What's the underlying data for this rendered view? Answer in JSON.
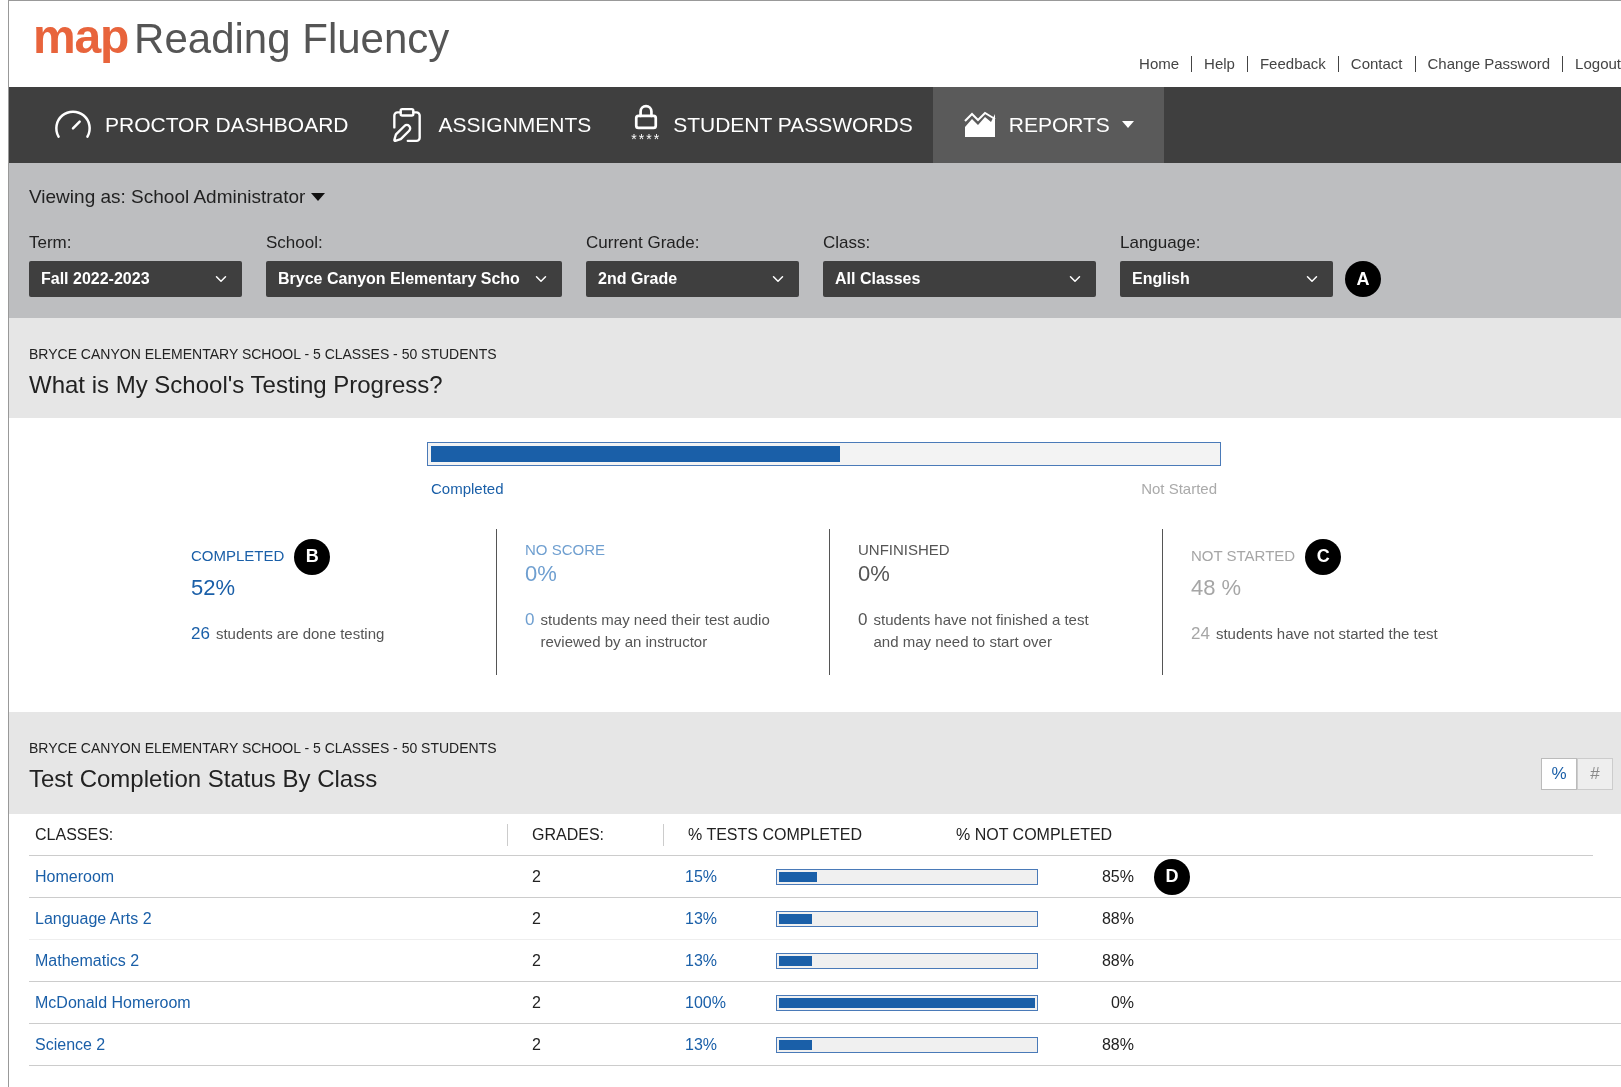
{
  "logo": {
    "brand": "map",
    "product": "Reading Fluency"
  },
  "top_links": [
    "Home",
    "Help",
    "Feedback",
    "Contact",
    "Change Password",
    "Logout"
  ],
  "nav": [
    {
      "kind": "dashboard",
      "label": "PROCTOR DASHBOARD",
      "selected": false
    },
    {
      "kind": "assignments",
      "label": "ASSIGNMENTS",
      "selected": false
    },
    {
      "kind": "passwords",
      "label": "STUDENT PASSWORDS",
      "badge": "****",
      "selected": false
    },
    {
      "kind": "reports",
      "label": "REPORTS",
      "selected": true,
      "has_menu": true
    }
  ],
  "viewing_as": "Viewing as: School Administrator",
  "filters": [
    {
      "label": "Term:",
      "value": "Fall 2022-2023"
    },
    {
      "label": "School:",
      "value": "Bryce Canyon Elementary Scho"
    },
    {
      "label": "Current Grade:",
      "value": "2nd Grade"
    },
    {
      "label": "Class:",
      "value": "All Classes"
    },
    {
      "label": "Language:",
      "value": "English",
      "callout": "A"
    }
  ],
  "progress_section": {
    "subtitle": "BRYCE CANYON ELEMENTARY SCHOOL - 5 CLASSES - 50 STUDENTS",
    "title": "What is My School's Testing Progress?",
    "bar": {
      "level": 0.52,
      "left_label": "Completed",
      "right_label": "Not Started"
    },
    "stats": [
      {
        "heading": "COMPLETED",
        "value": "52%",
        "count": "26",
        "description": "students are done testing",
        "color": "#1a5fa8",
        "callout": "B"
      },
      {
        "heading": "NO SCORE",
        "value": "0%",
        "count": "0",
        "description": "students may need their test audio reviewed by an instructor",
        "color": "#6f9fd0"
      },
      {
        "heading": "UNFINISHED",
        "value": "0%",
        "count": "0",
        "description": "students have not finished a test and may need to start over",
        "color": "#555555"
      },
      {
        "heading": "NOT STARTED",
        "value": "48 %",
        "count": "24",
        "description": "students have not started the test",
        "color": "#a6a6a6",
        "callout": "C"
      }
    ]
  },
  "class_section": {
    "subtitle": "BRYCE CANYON ELEMENTARY SCHOOL - 5 CLASSES - 50 STUDENTS",
    "title": "Test Completion Status By Class",
    "toggle": [
      {
        "label": "%",
        "selected": true
      },
      {
        "label": "#",
        "selected": false
      }
    ],
    "columns": [
      "CLASSES:",
      "GRADES:",
      "% TESTS COMPLETED",
      "% NOT COMPLETED"
    ],
    "rows": [
      {
        "class": "Homeroom",
        "grade": "2",
        "completed": "15%",
        "level": 0.15,
        "not_completed": "85%",
        "callout": "D"
      },
      {
        "class": "Language Arts 2",
        "grade": "2",
        "completed": "13%",
        "level": 0.13,
        "not_completed": "88%"
      },
      {
        "class": "Mathematics 2",
        "grade": "2",
        "completed": "13%",
        "level": 0.13,
        "not_completed": "88%"
      },
      {
        "class": "McDonald Homeroom",
        "grade": "2",
        "completed": "100%",
        "level": 1,
        "not_completed": "0%"
      },
      {
        "class": "Science 2",
        "grade": "2",
        "completed": "13%",
        "level": 0.13,
        "not_completed": "88%"
      }
    ]
  }
}
